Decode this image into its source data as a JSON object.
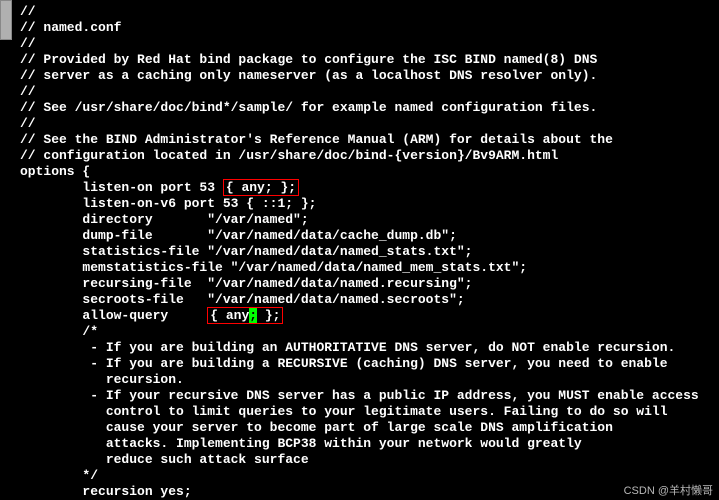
{
  "file": {
    "comment_lines": [
      "//",
      "// named.conf",
      "//",
      "// Provided by Red Hat bind package to configure the ISC BIND named(8) DNS",
      "// server as a caching only nameserver (as a localhost DNS resolver only).",
      "//",
      "// See /usr/share/doc/bind*/sample/ for example named configuration files.",
      "//",
      "// See the BIND Administrator's Reference Manual (ARM) for details about the",
      "// configuration located in /usr/share/doc/bind-{version}/Bv9ARM.html",
      ""
    ],
    "options_open": "options {",
    "listen_prefix": "        listen-on port 53 ",
    "listen_hl": "{ any; };",
    "listen_v6": "        listen-on-v6 port 53 { ::1; };",
    "directory": "        directory       \"/var/named\";",
    "dump_file": "        dump-file       \"/var/named/data/cache_dump.db\";",
    "stats_file": "        statistics-file \"/var/named/data/named_stats.txt\";",
    "memstats": "        memstatistics-file \"/var/named/data/named_mem_stats.txt\";",
    "recursing": "        recursing-file  \"/var/named/data/named.recursing\";",
    "secroots": "        secroots-file   \"/var/named/data/named.secroots\";",
    "allow_prefix": "        allow-query     ",
    "allow_hl_a": "{ any",
    "allow_cursor": ";",
    "allow_hl_b": " };",
    "blank": "",
    "bc_open": "        /*",
    "bc1": "         - If you are building an AUTHORITATIVE DNS server, do NOT enable recursion.",
    "bc2": "         - If you are building a RECURSIVE (caching) DNS server, you need to enable",
    "bc3": "           recursion.",
    "bc4": "         - If your recursive DNS server has a public IP address, you MUST enable access",
    "bc5": "           control to limit queries to your legitimate users. Failing to do so will",
    "bc6": "           cause your server to become part of large scale DNS amplification",
    "bc7": "           attacks. Implementing BCP38 within your network would greatly",
    "bc8": "           reduce such attack surface",
    "bc_close": "        */",
    "recursion": "        recursion yes;"
  },
  "watermark": "CSDN @羊村懒哥"
}
